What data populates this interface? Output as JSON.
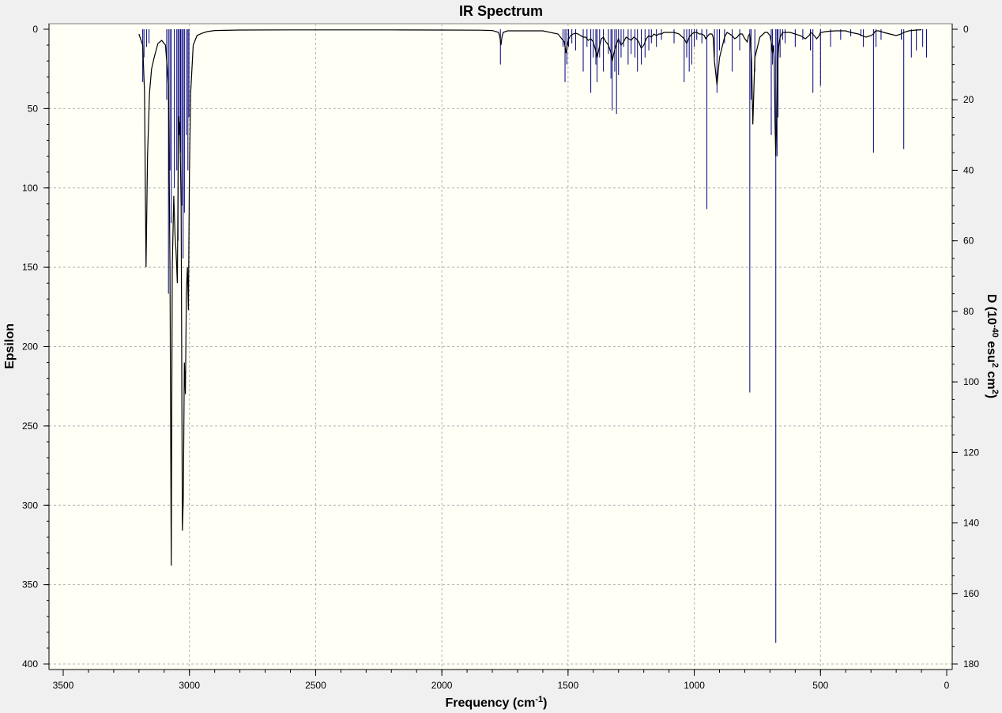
{
  "chart_data": {
    "type": "line",
    "title": "IR Spectrum",
    "xlabel": {
      "main": "Frequency (cm",
      "sup": "-1",
      "tail": ")"
    },
    "ylabel_left": "Epsilon",
    "ylabel_right": {
      "a": "D (10",
      "sup1": "-40",
      "b": " esu",
      "sup2": "2",
      "c": " cm",
      "sup3": "2",
      "d": ")"
    },
    "xlim": [
      3500,
      0
    ],
    "ylim_left": [
      0,
      400
    ],
    "ylim_right": [
      0,
      180
    ],
    "x_ticks": [
      3500,
      3000,
      2500,
      2000,
      1500,
      1000,
      500,
      0
    ],
    "y_left_ticks": [
      0,
      50,
      100,
      150,
      200,
      250,
      300,
      350,
      400
    ],
    "y_right_ticks": [
      0,
      20,
      40,
      60,
      80,
      100,
      120,
      140,
      160,
      180
    ],
    "grid": true,
    "colors": {
      "background": "#fffff6",
      "plot_border": "#808080",
      "grid": "#b4b4b4",
      "spectrum": "#000000",
      "sticks": "#000080"
    },
    "spectrum": {
      "name": "Epsilon",
      "x": [
        3200,
        3185,
        3178,
        3172,
        3166,
        3158,
        3150,
        3140,
        3125,
        3110,
        3095,
        3083,
        3077,
        3072,
        3068,
        3062,
        3057,
        3053,
        3048,
        3043,
        3038,
        3033,
        3028,
        3024,
        3020,
        3016,
        3012,
        3008,
        3004,
        3000,
        2995,
        2985,
        2970,
        2950,
        2930,
        2900,
        2800,
        2600,
        2400,
        2200,
        2000,
        1850,
        1800,
        1775,
        1770,
        1766,
        1762,
        1757,
        1740,
        1600,
        1540,
        1515,
        1508,
        1503,
        1497,
        1490,
        1480,
        1470,
        1460,
        1450,
        1440,
        1430,
        1420,
        1410,
        1400,
        1393,
        1385,
        1377,
        1368,
        1360,
        1350,
        1340,
        1330,
        1325,
        1320,
        1312,
        1305,
        1300,
        1290,
        1280,
        1270,
        1260,
        1250,
        1240,
        1230,
        1220,
        1210,
        1200,
        1190,
        1180,
        1170,
        1160,
        1150,
        1140,
        1130,
        1120,
        1100,
        1080,
        1060,
        1040,
        1030,
        1020,
        1015,
        1010,
        1000,
        990,
        980,
        970,
        960,
        955,
        950,
        940,
        935,
        930,
        925,
        920,
        910,
        900,
        880,
        870,
        850,
        840,
        830,
        820,
        810,
        800,
        790,
        785,
        780,
        777,
        773,
        768,
        760,
        740,
        720,
        710,
        700,
        695,
        690,
        686,
        683,
        680,
        677,
        674,
        670,
        665,
        660,
        650,
        640,
        620,
        600,
        580,
        560,
        545,
        538,
        532,
        525,
        515,
        505,
        500,
        495,
        480,
        460,
        440,
        420,
        400,
        380,
        350,
        320,
        300,
        290,
        285,
        280,
        270,
        250,
        200,
        180,
        170,
        160,
        150,
        140,
        120,
        100,
        80,
        70
      ],
      "y": [
        3,
        10,
        40,
        150,
        80,
        40,
        25,
        18,
        9,
        7,
        10,
        35,
        150,
        338,
        150,
        105,
        130,
        140,
        160,
        55,
        60,
        110,
        316,
        295,
        210,
        230,
        165,
        150,
        177,
        90,
        40,
        10,
        4,
        2.5,
        1.5,
        0.8,
        0.5,
        0.4,
        0.4,
        0.4,
        0.5,
        0.6,
        0.8,
        2,
        5,
        10,
        5,
        2,
        1,
        1,
        3,
        8,
        15,
        10,
        6,
        4,
        3,
        2.5,
        3,
        4,
        5,
        5,
        7,
        6,
        8,
        12,
        18,
        12,
        6,
        5,
        8,
        10,
        15,
        20,
        16,
        11,
        8,
        6,
        10,
        8,
        5,
        6,
        7,
        5,
        6,
        8,
        12,
        10,
        6,
        4,
        5,
        3,
        4,
        3,
        3,
        2,
        2,
        2,
        3,
        6,
        9,
        5,
        4,
        3,
        2,
        2,
        3,
        3,
        4,
        6,
        5,
        3,
        3,
        3,
        5,
        20,
        35,
        18,
        5,
        2,
        4,
        6,
        5,
        3,
        3,
        6,
        8,
        4,
        3,
        8,
        20,
        60,
        18,
        5,
        2,
        2,
        4,
        8,
        15,
        10,
        20,
        60,
        80,
        60,
        22,
        10,
        5,
        2,
        2,
        2,
        3,
        4,
        6,
        4,
        2,
        3,
        4,
        6,
        4,
        2,
        2,
        1.5,
        1.2,
        1,
        1,
        1,
        2,
        3,
        5,
        4,
        3,
        1.5,
        1,
        1,
        2,
        4,
        3,
        2,
        1.5,
        1,
        0.8,
        0.5,
        0.3
      ]
    },
    "sticks": {
      "name": "D",
      "x": [
        3185,
        3180,
        3170,
        3160,
        3090,
        3083,
        3077,
        3072,
        3060,
        3050,
        3045,
        3040,
        3035,
        3030,
        3025,
        3020,
        3012,
        3006,
        3002,
        1768,
        1520,
        1512,
        1505,
        1498,
        1485,
        1470,
        1440,
        1425,
        1410,
        1400,
        1390,
        1385,
        1375,
        1360,
        1340,
        1330,
        1325,
        1315,
        1308,
        1300,
        1290,
        1280,
        1262,
        1250,
        1235,
        1225,
        1210,
        1195,
        1180,
        1170,
        1150,
        1130,
        1080,
        1040,
        1030,
        1020,
        1010,
        1000,
        990,
        970,
        950,
        920,
        910,
        900,
        880,
        850,
        820,
        780,
        775,
        760,
        695,
        690,
        677,
        672,
        668,
        660,
        650,
        640,
        600,
        570,
        540,
        530,
        500,
        460,
        420,
        380,
        340,
        330,
        290,
        280,
        260,
        180,
        170,
        140,
        120,
        95,
        80
      ],
      "y": [
        15,
        8,
        5,
        4,
        20,
        75,
        40,
        55,
        45,
        40,
        60,
        30,
        35,
        50,
        65,
        52,
        30,
        40,
        25,
        10,
        5,
        15,
        10,
        5,
        4,
        6,
        12,
        5,
        18,
        8,
        10,
        15,
        8,
        12,
        7,
        14,
        23,
        12,
        24,
        13,
        8,
        5,
        10,
        7,
        8,
        12,
        10,
        8,
        6,
        4,
        5,
        3,
        4,
        15,
        8,
        12,
        10,
        5,
        3,
        4,
        51,
        8,
        18,
        6,
        4,
        12,
        6,
        103,
        20,
        12,
        30,
        10,
        174,
        36,
        25,
        8,
        3,
        4,
        5,
        3,
        6,
        18,
        16,
        5,
        3,
        2,
        2,
        5,
        35,
        5,
        3,
        3,
        34,
        8,
        6,
        5,
        8
      ]
    }
  }
}
